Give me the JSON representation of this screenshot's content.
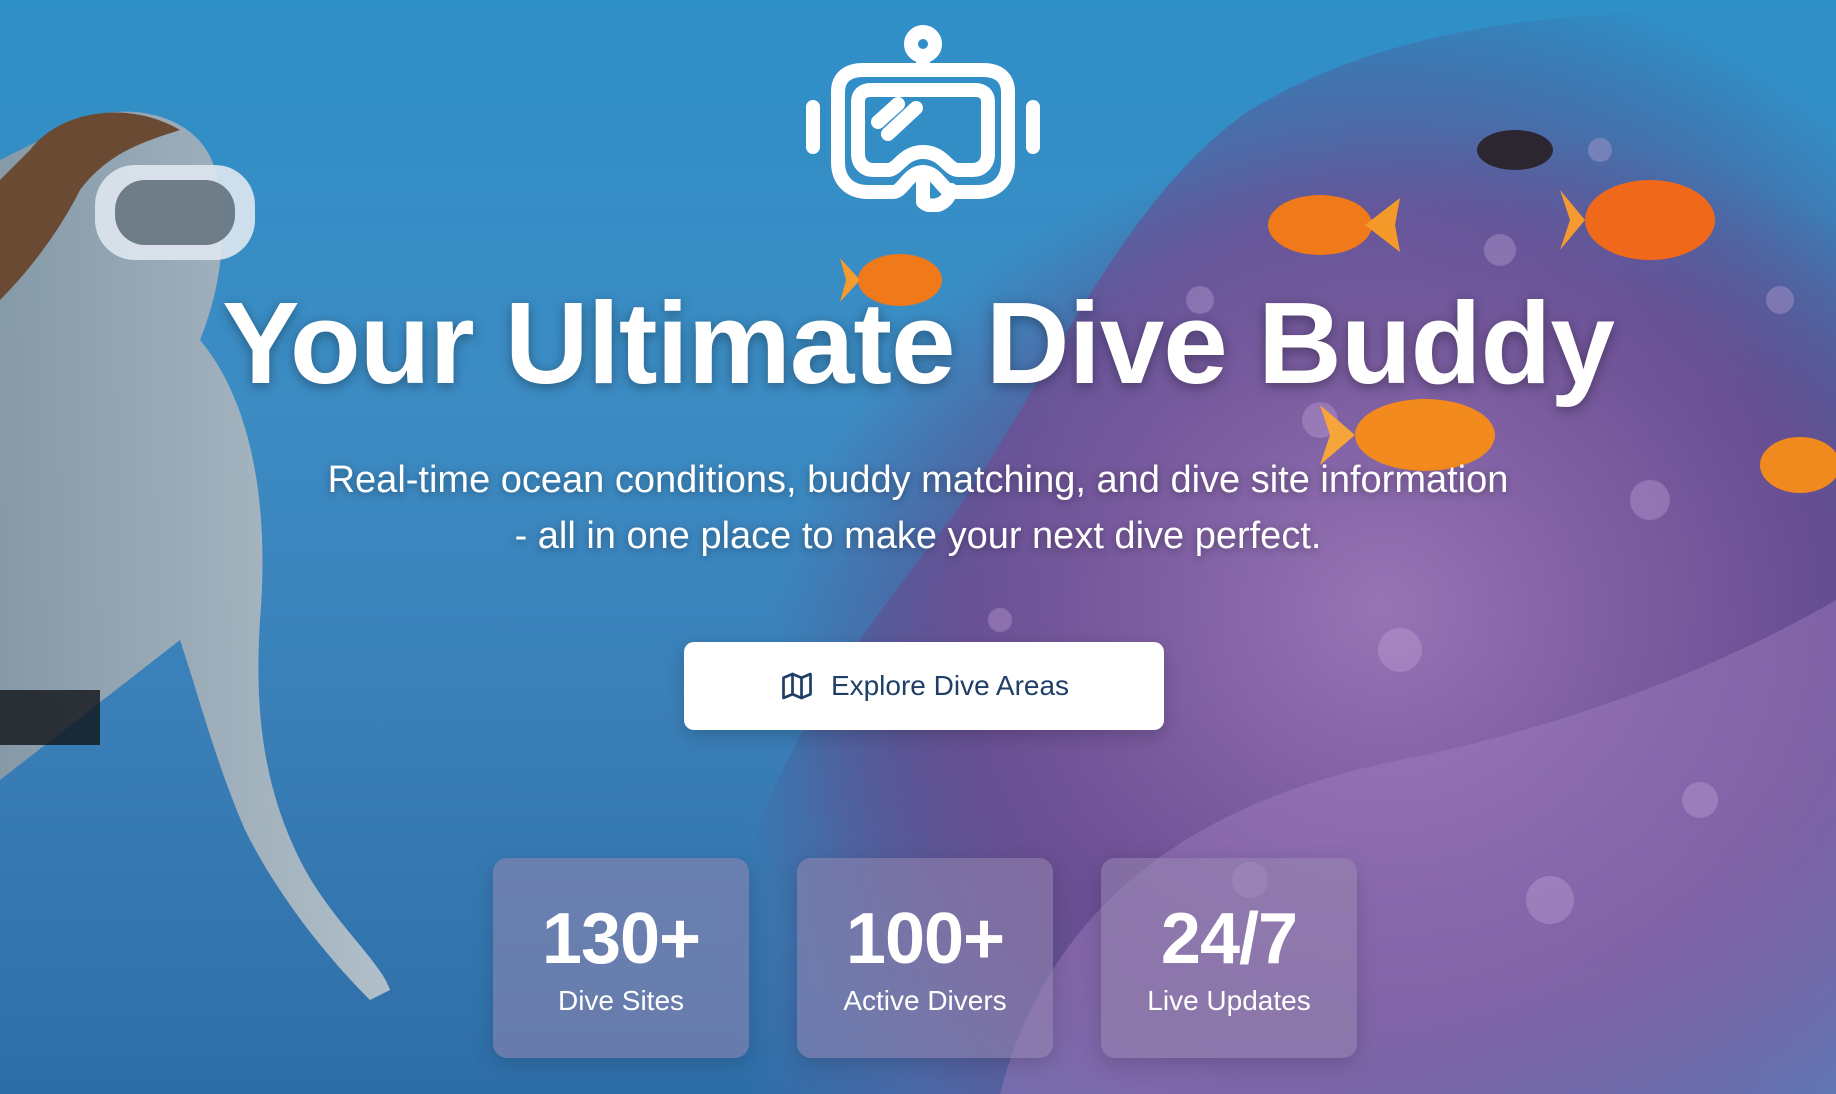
{
  "hero": {
    "logo_icon": "dive-mask-snorkel-icon",
    "title": "Your Ultimate Dive Buddy",
    "subtitle_line1": "Real-time ocean conditions, buddy matching, and dive site information",
    "subtitle_line2": "- all in one place to make your next dive perfect.",
    "cta": {
      "icon": "map-icon",
      "label": "Explore Dive Areas"
    }
  },
  "stats": [
    {
      "value": "130+",
      "label": "Dive Sites"
    },
    {
      "value": "100+",
      "label": "Active Divers"
    },
    {
      "value": "24/7",
      "label": "Live Updates"
    }
  ],
  "colors": {
    "cta_text": "#1f3f66",
    "cta_bg": "#ffffff",
    "title_text": "#ffffff",
    "ocean_blue": "#3c8cc4",
    "coral_purple": "#7a55a0"
  }
}
